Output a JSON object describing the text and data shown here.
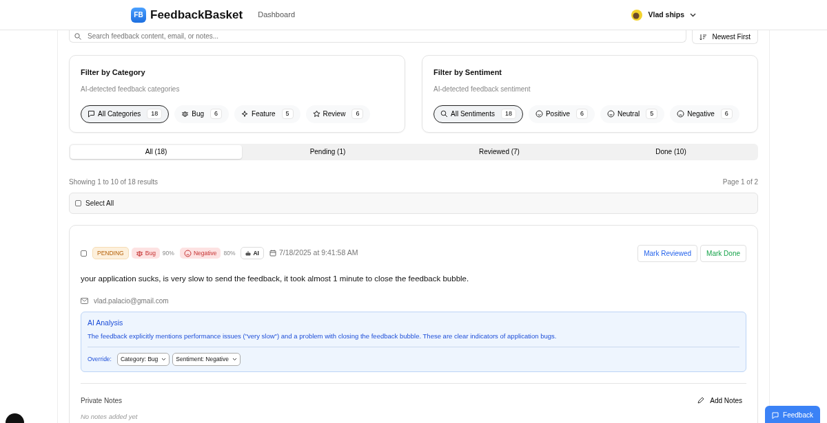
{
  "header": {
    "logo_mark": "FB",
    "brand": "FeedbackBasket",
    "nav": [
      {
        "label": "Dashboard",
        "selected": false
      }
    ],
    "user": "Vlad ships"
  },
  "search": {
    "placeholder": "Search feedback content, email, or notes..."
  },
  "sort": {
    "label": "Newest First"
  },
  "filters": [
    {
      "title": "Filter by Category",
      "subtitle": "AI-detected feedback categories",
      "options": [
        {
          "kind": "chat",
          "label": "All Categories",
          "count": "18",
          "selected": true
        },
        {
          "kind": "bug",
          "label": "Bug",
          "count": "6",
          "selected": false
        },
        {
          "kind": "sparkle",
          "label": "Feature",
          "count": "5",
          "selected": false
        },
        {
          "kind": "star",
          "label": "Review",
          "count": "6",
          "selected": false
        }
      ]
    },
    {
      "title": "Filter by Sentiment",
      "subtitle": "AI-detected feedback sentiment",
      "options": [
        {
          "kind": "search",
          "label": "All Sentiments",
          "count": "18",
          "selected": true
        },
        {
          "kind": "smile",
          "label": "Positive",
          "count": "6",
          "selected": false
        },
        {
          "kind": "neutral",
          "label": "Neutral",
          "count": "5",
          "selected": false
        },
        {
          "kind": "frown",
          "label": "Negative",
          "count": "6",
          "selected": false
        }
      ]
    }
  ],
  "status_tabs": [
    {
      "label": "All (18)",
      "selected": true
    },
    {
      "label": "Pending (1)",
      "selected": false
    },
    {
      "label": "Reviewed (7)",
      "selected": false
    },
    {
      "label": "Done (10)",
      "selected": false
    }
  ],
  "results_summary": "Showing 1 to 10 of 18 results",
  "page_info": "Page 1 of 2",
  "select_all": {
    "label": "Select All",
    "checked": false
  },
  "feedback": [
    {
      "checked": false,
      "status": "PENDING",
      "category": "Bug",
      "category_confidence": "90%",
      "sentiment": "Negative",
      "sentiment_confidence": "80%",
      "source_badge": "AI",
      "date": "7/18/2025 at 9:41:58 AM",
      "actions": [
        "Mark Reviewed",
        "Mark Done"
      ],
      "message": "your application sucks, is very slow to send the feedback, it took almost 1 minute to close the feedback bubble.",
      "email": "vlad.palacio@gmail.com",
      "analysis_title": "AI Analysis",
      "analysis": "The feedback explicitly mentions performance issues (\"very slow\") and a problem with closing the feedback bubble. These are clear indicators of application bugs.",
      "override_label": "Override:",
      "override_category": "Category: Bug",
      "override_sentiment": "Sentiment: Negative",
      "notes_title": "Private Notes",
      "notes_button": "Add Notes",
      "notes_empty": "No notes added yet"
    }
  ],
  "feedback_button": "Feedback"
}
